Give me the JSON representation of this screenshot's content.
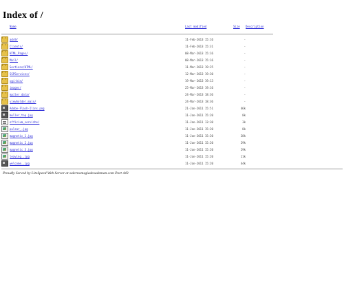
{
  "page": {
    "title": "Index of /",
    "footer": "Proudly Served by LiteSpeed Web Server at salernomsgiadesademan.com Port 443"
  },
  "headers": {
    "name": "Name",
    "last_modified": "Last modified",
    "size": "Size",
    "description": "Description"
  },
  "rows": [
    {
      "icon": "folder-icon",
      "name": "ads9/",
      "date": "11-Feb-2013 15:16",
      "size": "-"
    },
    {
      "icon": "folder-icon",
      "name": "Clients/",
      "date": "11-Feb-2013 15:31",
      "size": "-"
    },
    {
      "icon": "folder-icon",
      "name": "HTML_Pages/",
      "date": "08-Mar-2013 15:16",
      "size": "-"
    },
    {
      "icon": "folder-icon",
      "name": "Mail/",
      "date": "08-Mar-2013 15:16",
      "size": "-"
    },
    {
      "icon": "folder-icon",
      "name": "Sections/HTML/",
      "date": "11-Mar-2013 19:25",
      "size": "-"
    },
    {
      "icon": "folder-icon",
      "name": "SSPServices/",
      "date": "12-Mar-2013 19:30",
      "size": "-"
    },
    {
      "icon": "folder-icon",
      "name": "cgi-bin/",
      "date": "19-Mar-2013 19:13",
      "size": "-"
    },
    {
      "icon": "folder-icon",
      "name": "images/",
      "date": "25-Mar-2013 19:16",
      "size": "-"
    },
    {
      "icon": "folder-icon",
      "name": "mailer_data/",
      "date": "24-Mar-2013 18:36",
      "size": "-"
    },
    {
      "icon": "folder-icon",
      "name": "viewholder_main/",
      "date": "24-Mar-2013 18:36",
      "size": "-"
    },
    {
      "icon": "image-icon",
      "name": "Adobe-Flash-Ilins.png",
      "date": "21-Jan-2011 15:51",
      "size": "46k"
    },
    {
      "icon": "image-icon",
      "name": "muller_top.jpg",
      "date": "11-Jan-2011 15:20",
      "size": "8k"
    },
    {
      "icon": "text-icon",
      "name": "officium_servizhe/",
      "date": "11-Jan-2011 13:30",
      "size": "3k"
    },
    {
      "icon": "file-icon",
      "name": "pulsar_.jpg",
      "date": "11-Jan-2011 15:20",
      "size": "8k"
    },
    {
      "icon": "file-icon",
      "name": "magnetic_1.jpg",
      "date": "11-Jan-2011 15:20",
      "size": "28k"
    },
    {
      "icon": "file-icon",
      "name": "magnetic_2.jpg",
      "date": "11-Jan-2011 15:20",
      "size": "29k"
    },
    {
      "icon": "file-icon",
      "name": "magnetic_3.jpg",
      "date": "11-Jan-2011 15:20",
      "size": "29k"
    },
    {
      "icon": "file-icon",
      "name": "leaving_.jpg",
      "date": "11-Jan-2011 15:20",
      "size": "11k"
    },
    {
      "icon": "image-icon",
      "name": "welcome_.jpg",
      "date": "11-Jan-2011 15:20",
      "size": "44k"
    }
  ]
}
